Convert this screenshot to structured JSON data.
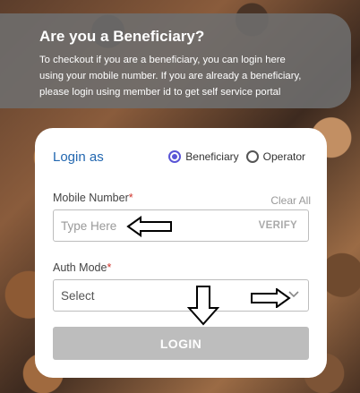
{
  "banner": {
    "title": "Are you a Beneficiary?",
    "line1": "To checkout if you are a beneficiary, you can login here",
    "line2": "using your mobile number. If you are already a beneficiary,",
    "line3": "please login using member id to get self service portal"
  },
  "login": {
    "title": "Login as",
    "options": [
      {
        "label": "Beneficiary",
        "selected": true
      },
      {
        "label": "Operator",
        "selected": false
      }
    ]
  },
  "mobile": {
    "label": "Mobile Number",
    "required_mark": "*",
    "clear_label": "Clear All",
    "placeholder": "Type Here",
    "verify_label": "VERIFY"
  },
  "auth": {
    "label": "Auth Mode",
    "required_mark": "*",
    "selected": "Select"
  },
  "submit": {
    "label": "LOGIN"
  },
  "colors": {
    "accent": "#2267b0",
    "radio_selected": "#5a55d6",
    "required": "#d0342c",
    "button_disabled": "#bdbdbd"
  }
}
